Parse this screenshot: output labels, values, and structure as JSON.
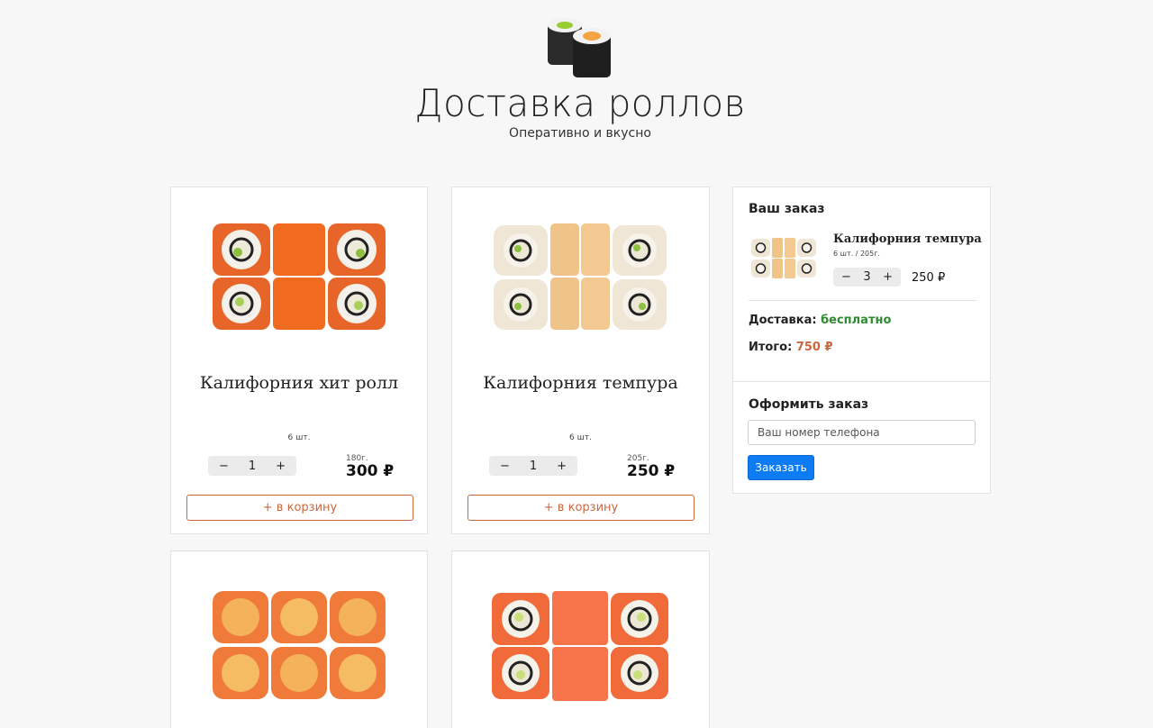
{
  "header": {
    "title": "Доставка роллов",
    "subtitle": "Оперативно и вкусно",
    "logo_icon": "sushi-rolls-logo-icon"
  },
  "products": [
    {
      "name": "Калифорния хит ролл",
      "pieces": "6 шт.",
      "quantity": "1",
      "weight": "180г.",
      "price": "300 ₽",
      "add_label": "+ в корзину",
      "minus": "−",
      "plus": "+"
    },
    {
      "name": "Калифорния темпура",
      "pieces": "6 шт.",
      "quantity": "1",
      "weight": "205г.",
      "price": "250 ₽",
      "add_label": "+ в корзину",
      "minus": "−",
      "plus": "+"
    },
    {
      "name": "",
      "pieces": "",
      "quantity": "",
      "weight": "",
      "price": "",
      "add_label": ""
    },
    {
      "name": "",
      "pieces": "",
      "quantity": "",
      "weight": "",
      "price": "",
      "add_label": ""
    }
  ],
  "cart": {
    "title": "Ваш заказ",
    "item": {
      "name": "Калифорния темпура",
      "meta": "6 шт. / 205г.",
      "quantity": "3",
      "price": "250 ₽",
      "minus": "−",
      "plus": "+"
    },
    "delivery_label": "Доставка:",
    "delivery_value": "бесплатно",
    "total_label": "Итого:",
    "total_value": "750 ₽",
    "checkout_title": "Оформить заказ",
    "phone_placeholder": "Ваш номер телефона",
    "order_button": "Заказать"
  },
  "colors": {
    "accent": "#c8683f",
    "delivery_green": "#2e8b2e",
    "primary_button": "#0d7cf2",
    "background": "#f7f7f7"
  }
}
